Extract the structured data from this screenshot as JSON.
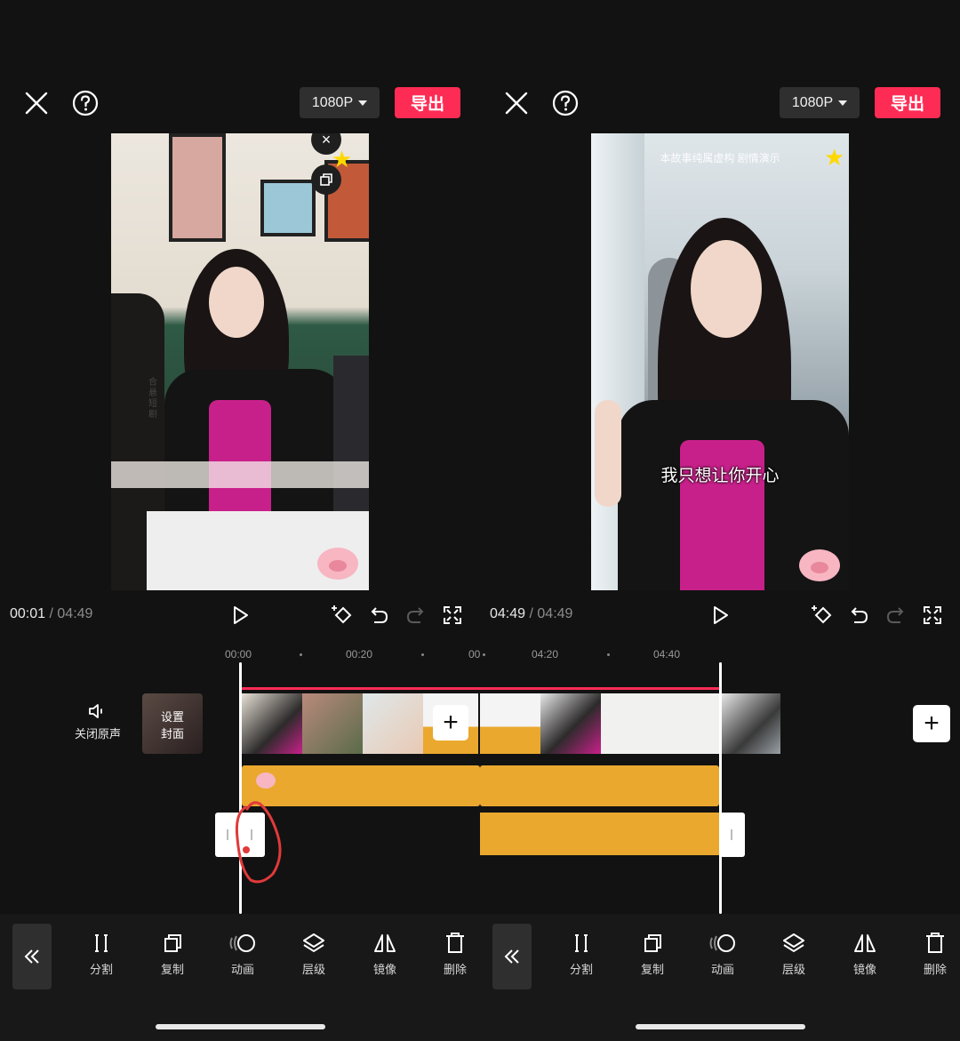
{
  "left": {
    "header": {
      "resolution": "1080P",
      "export_label": "导出"
    },
    "controls": {
      "current_time": "00:01",
      "separator": "/",
      "duration": "04:49"
    },
    "preview": {
      "side_watermark": "合悬短剧"
    },
    "timeline": {
      "ticks": [
        "00:00",
        "00:20",
        "00:",
        "04:20",
        "04:40"
      ],
      "mute_label": "关闭原声",
      "cover_label_1": "设置",
      "cover_label_2": "封面"
    },
    "toolbar": {
      "tools": [
        {
          "label": "分割",
          "icon": "split-icon"
        },
        {
          "label": "复制",
          "icon": "copy-icon"
        },
        {
          "label": "动画",
          "icon": "animation-icon"
        },
        {
          "label": "层级",
          "icon": "layers-icon"
        },
        {
          "label": "镜像",
          "icon": "mirror-icon"
        },
        {
          "label": "删除",
          "icon": "delete-icon"
        }
      ]
    }
  },
  "right": {
    "header": {
      "resolution": "1080P",
      "export_label": "导出"
    },
    "controls": {
      "current_time": "04:49",
      "separator": "/",
      "duration": "04:49"
    },
    "preview": {
      "disclaimer": "本故事纯属虚构 剧情演示",
      "subtitle": "我只想让你开心"
    },
    "toolbar": {
      "tools": [
        {
          "label": "分割",
          "icon": "split-icon"
        },
        {
          "label": "复制",
          "icon": "copy-icon"
        },
        {
          "label": "动画",
          "icon": "animation-icon"
        },
        {
          "label": "层级",
          "icon": "layers-icon"
        },
        {
          "label": "镜像",
          "icon": "mirror-icon"
        },
        {
          "label": "删除",
          "icon": "delete-icon"
        }
      ]
    }
  },
  "colors": {
    "accent": "#fe2c55",
    "track": "#eaa82e",
    "background": "#121212",
    "toolbar": "#181818"
  }
}
